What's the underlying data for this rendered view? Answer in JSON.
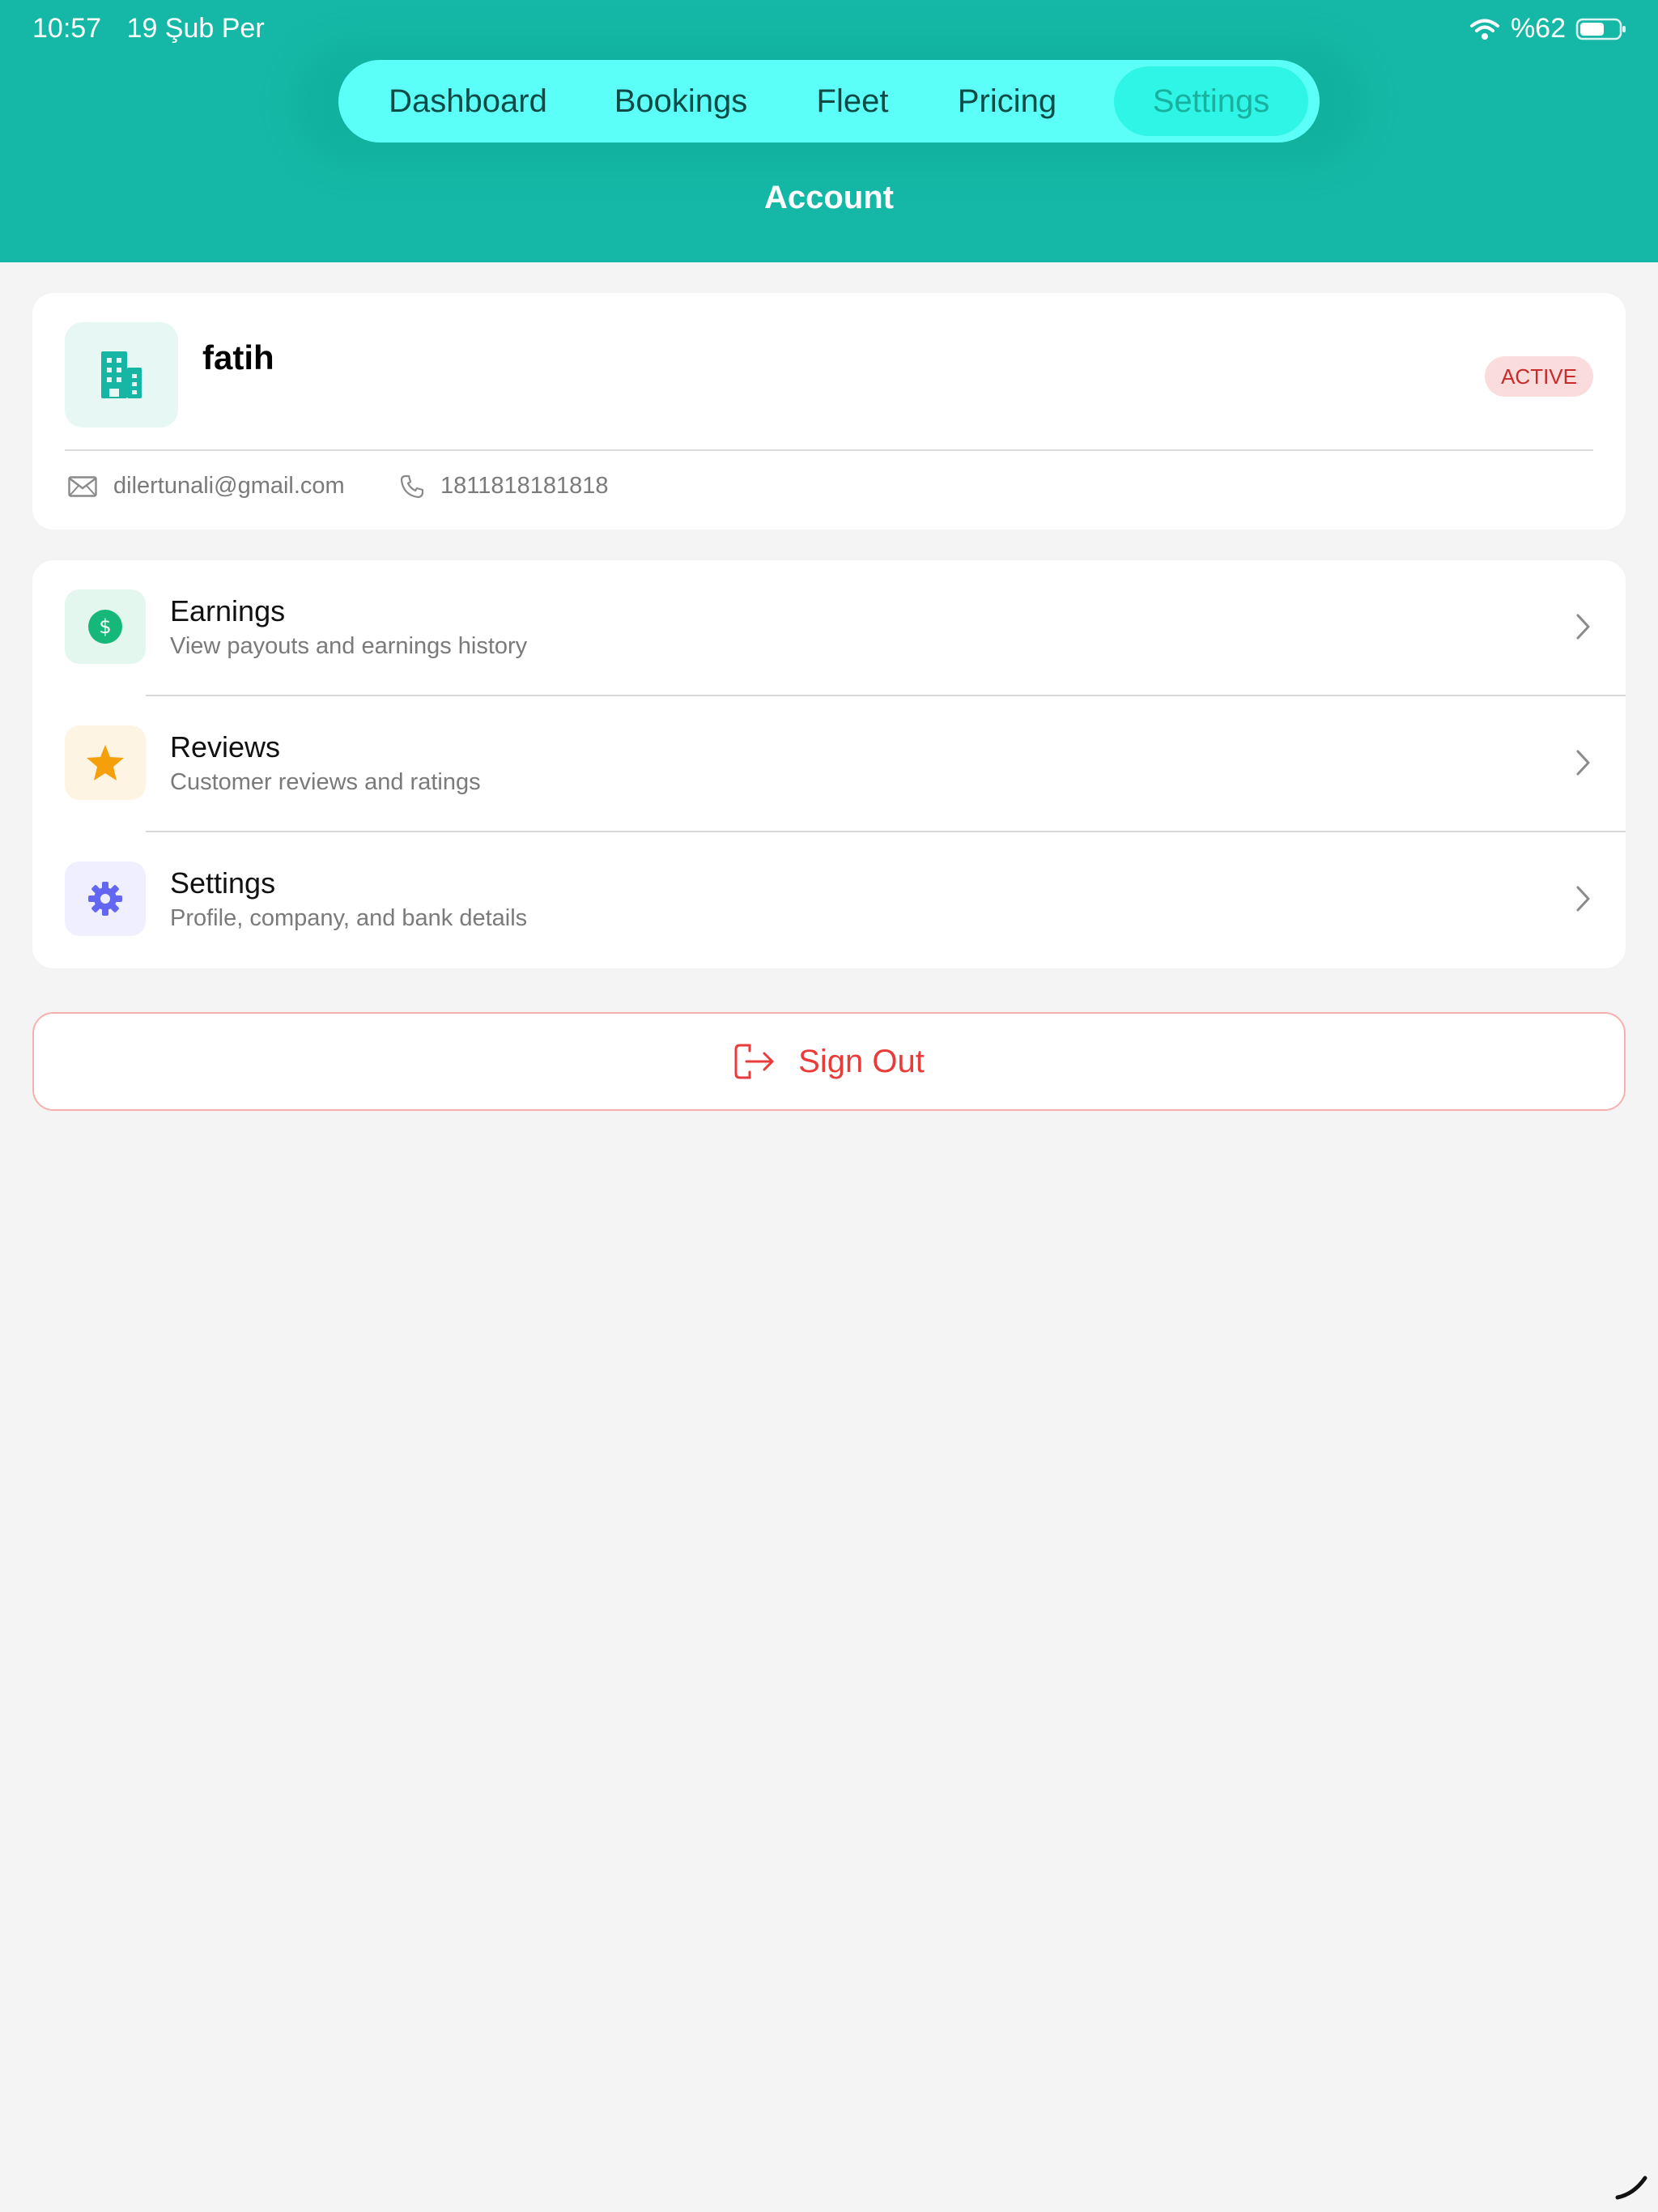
{
  "status_bar": {
    "time": "10:57",
    "date": "19 Şub Per",
    "battery_label": "%62",
    "battery_level": 0.62
  },
  "nav": {
    "tabs": [
      {
        "label": "Dashboard",
        "active": false
      },
      {
        "label": "Bookings",
        "active": false
      },
      {
        "label": "Fleet",
        "active": false
      },
      {
        "label": "Pricing",
        "active": false
      },
      {
        "label": "Settings",
        "active": true
      }
    ]
  },
  "page": {
    "title": "Account"
  },
  "profile": {
    "avatar_icon": "building-icon",
    "name": "fatih",
    "status": "ACTIVE",
    "email": "dilertunali@gmail.com",
    "phone": "1811818181818"
  },
  "menu": {
    "items": [
      {
        "title": "Earnings",
        "subtitle": "View payouts and earnings history",
        "icon": "dollar-icon"
      },
      {
        "title": "Reviews",
        "subtitle": "Customer reviews and ratings",
        "icon": "star-icon"
      },
      {
        "title": "Settings",
        "subtitle": "Profile, company, and bank details",
        "icon": "gear-icon"
      }
    ]
  },
  "sign_out": {
    "label": "Sign Out",
    "icon": "logout-icon"
  },
  "colors": {
    "header": "#15b8a6",
    "nav_bg": "#5cfff8",
    "nav_active": "#2ff5e6",
    "badge_bg": "#fbdcdc",
    "badge_text": "#c82b2b",
    "danger": "#ea3b3b",
    "earnings_accent": "#16b87a",
    "reviews_accent": "#f5a00b",
    "settings_accent": "#6366f1"
  }
}
